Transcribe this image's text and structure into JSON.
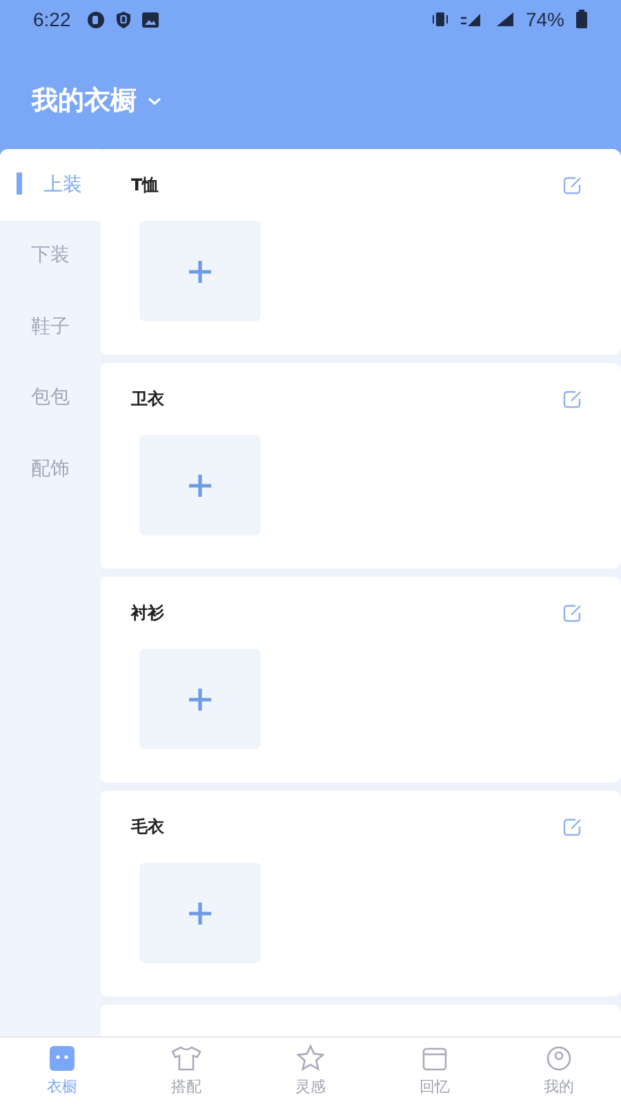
{
  "status_bar": {
    "time": "6:22",
    "battery": "74%"
  },
  "header": {
    "title": "我的衣橱"
  },
  "sidebar": {
    "items": [
      {
        "label": "上装",
        "selected": true
      },
      {
        "label": "下装",
        "selected": false
      },
      {
        "label": "鞋子",
        "selected": false
      },
      {
        "label": "包包",
        "selected": false
      },
      {
        "label": "配饰",
        "selected": false
      }
    ]
  },
  "categories": [
    {
      "title": "T恤"
    },
    {
      "title": "卫衣"
    },
    {
      "title": "衬衫"
    },
    {
      "title": "毛衣"
    },
    {
      "kind": "partial"
    }
  ],
  "tab_bar": [
    {
      "label": "衣橱",
      "selected": true
    },
    {
      "label": "搭配",
      "selected": false
    },
    {
      "label": "灵感",
      "selected": false
    },
    {
      "label": "回忆",
      "selected": false
    },
    {
      "label": "我的",
      "selected": false
    }
  ]
}
